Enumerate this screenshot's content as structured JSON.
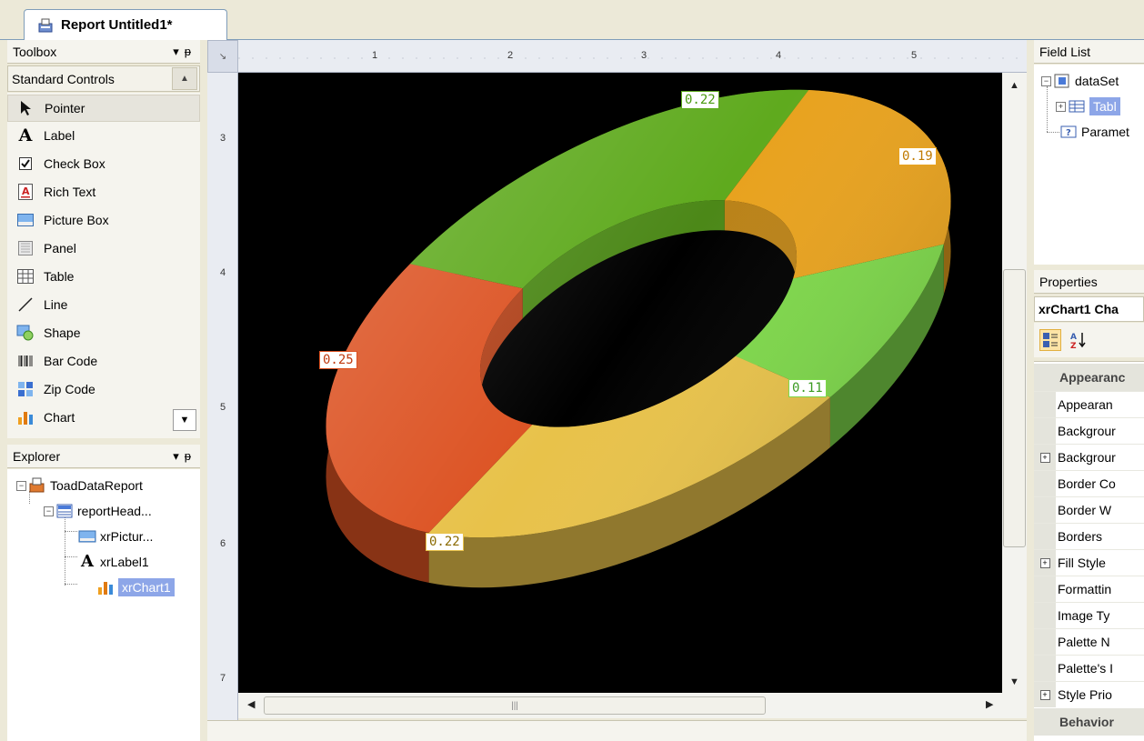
{
  "document": {
    "tab_title": "Report Untitled1*"
  },
  "toolbox": {
    "title": "Toolbox",
    "pin_glyph": "▾ ᵽ",
    "section": "Standard Controls",
    "items": [
      {
        "label": "Pointer",
        "icon": "pointer-icon"
      },
      {
        "label": "Label",
        "icon": "label-icon"
      },
      {
        "label": "Check Box",
        "icon": "checkbox-icon"
      },
      {
        "label": "Rich Text",
        "icon": "rich-text-icon"
      },
      {
        "label": "Picture Box",
        "icon": "picture-box-icon"
      },
      {
        "label": "Panel",
        "icon": "panel-icon"
      },
      {
        "label": "Table",
        "icon": "table-icon"
      },
      {
        "label": "Line",
        "icon": "line-icon"
      },
      {
        "label": "Shape",
        "icon": "shape-icon"
      },
      {
        "label": "Bar Code",
        "icon": "barcode-icon"
      },
      {
        "label": "Zip Code",
        "icon": "zipcode-icon"
      },
      {
        "label": "Chart",
        "icon": "chart-icon"
      }
    ]
  },
  "explorer": {
    "title": "Explorer",
    "nodes": [
      "ToadDataReport",
      "reportHead...",
      "xrPictur...",
      "xrLabel1",
      "xrChart1"
    ]
  },
  "ruler": {
    "top_numbers": [
      "1",
      "2",
      "3",
      "4",
      "5"
    ],
    "left_numbers": [
      "3",
      "4",
      "5",
      "6",
      "7"
    ]
  },
  "chart_data": {
    "type": "pie",
    "style": "3d-doughnut",
    "labels": [
      "0.22",
      "0.19",
      "0.11",
      "0.22",
      "0.25"
    ],
    "values": [
      0.22,
      0.19,
      0.11,
      0.22,
      0.25
    ],
    "colors": [
      "#5faa1e",
      "#e8a21e",
      "#7ed84a",
      "#e8c24a",
      "#dc5222"
    ],
    "background": "#000000"
  },
  "field_list": {
    "title": "Field List",
    "nodes": [
      "dataSet",
      "Tabl",
      "Paramet"
    ]
  },
  "properties": {
    "title": "Properties",
    "object": "xrChart1  Cha",
    "categories": [
      "Appearanc",
      "Behavior"
    ],
    "rows": [
      {
        "label": "Appearan",
        "expandable": false
      },
      {
        "label": "Backgrour",
        "expandable": false
      },
      {
        "label": "Backgrour",
        "expandable": true
      },
      {
        "label": "Border Co",
        "expandable": false
      },
      {
        "label": "Border W",
        "expandable": false
      },
      {
        "label": "Borders",
        "expandable": false
      },
      {
        "label": "Fill Style",
        "expandable": true
      },
      {
        "label": "Formattin",
        "expandable": false
      },
      {
        "label": "Image Ty",
        "expandable": false
      },
      {
        "label": "Palette N",
        "expandable": false
      },
      {
        "label": "Palette's I",
        "expandable": false
      },
      {
        "label": "Style Prio",
        "expandable": true
      }
    ]
  }
}
